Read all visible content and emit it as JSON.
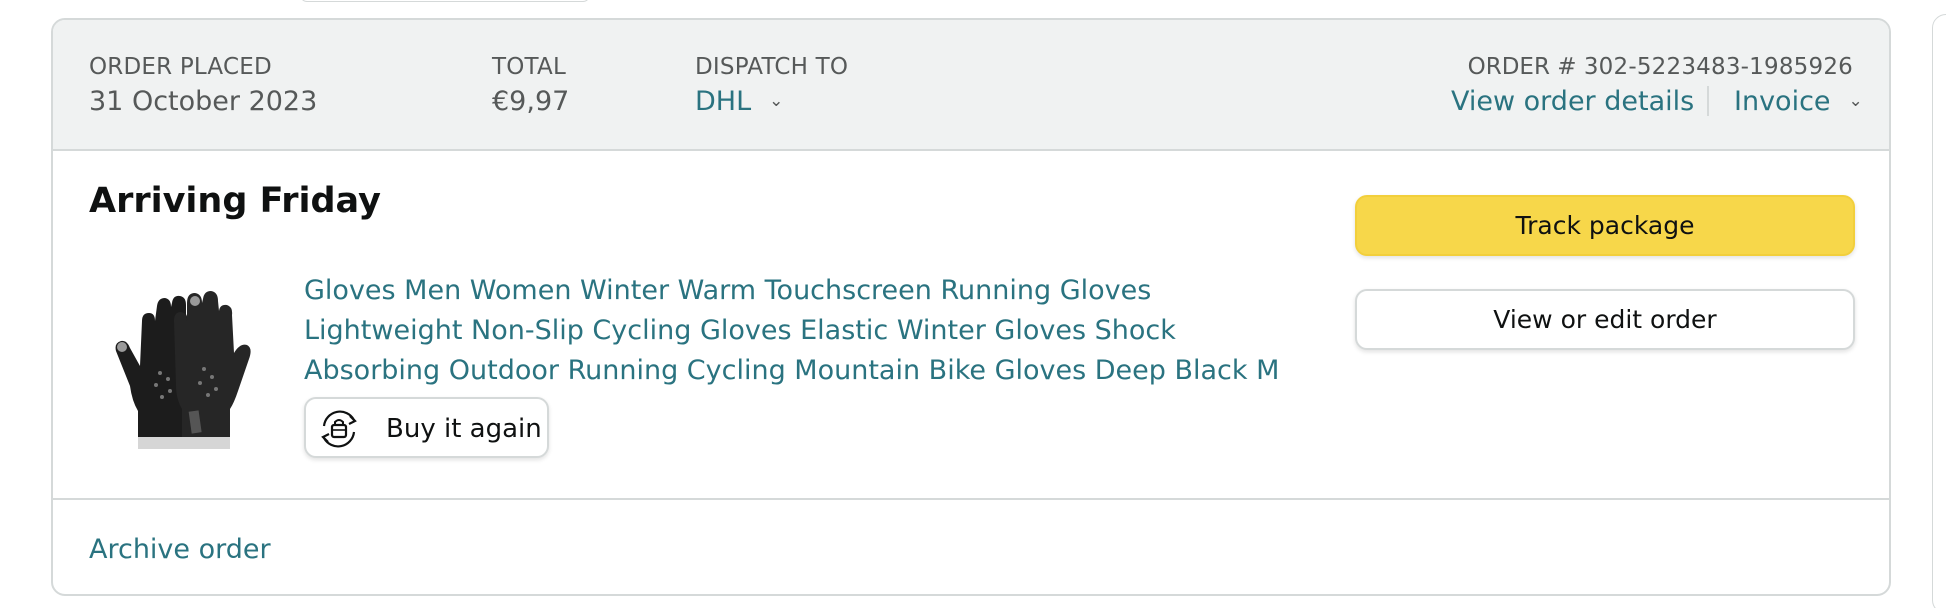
{
  "header": {
    "order_placed_label": "ORDER PLACED",
    "order_placed_value": "31 October 2023",
    "total_label": "TOTAL",
    "total_value": "€9,97",
    "dispatch_label": "DISPATCH TO",
    "dispatch_value": "DHL",
    "order_number_label": "ORDER #",
    "order_number_value": "302-5223483-1985926",
    "view_details_link": "View order details",
    "invoice_link": "Invoice"
  },
  "shipment": {
    "status": "Arriving Friday",
    "item": {
      "title": "Gloves Men Women Winter Warm Touchscreen Running Gloves Lightweight Non-Slip Cycling Gloves Elastic Winter Gloves Shock Absorbing Outdoor Running Cycling Mountain Bike Gloves Deep Black M",
      "buy_again_label": "Buy it again"
    },
    "actions": {
      "track_label": "Track package",
      "edit_label": "View or edit order"
    }
  },
  "footer": {
    "archive_link": "Archive order"
  },
  "icons": {
    "chevron": "chevron-down-icon",
    "buy_again": "buy-again-icon",
    "product": "gloves-image"
  },
  "colors": {
    "link": "#2a7380",
    "header_bg": "#f0f2f2",
    "track_button": "#f7d74a",
    "border": "#d5d9d9"
  }
}
